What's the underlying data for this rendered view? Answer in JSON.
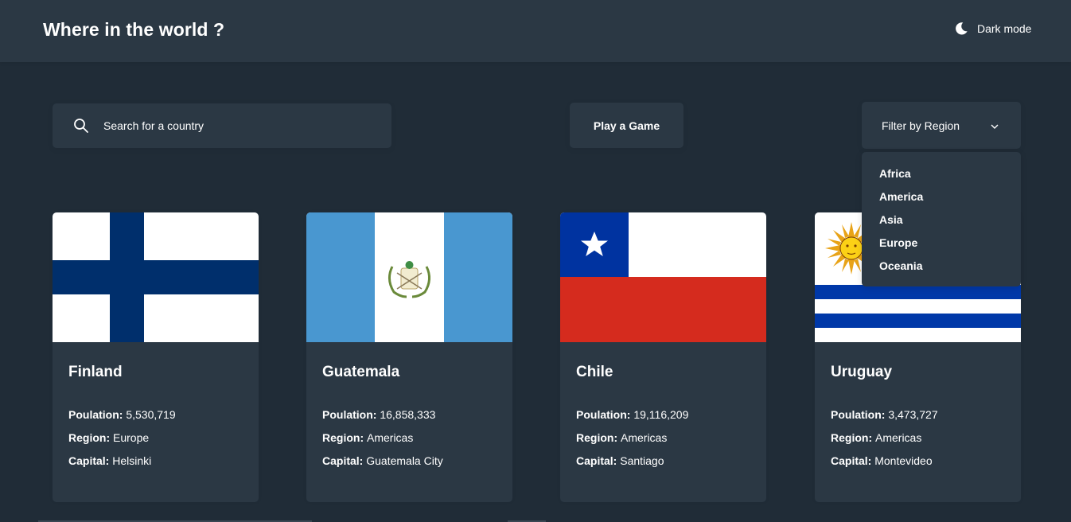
{
  "header": {
    "title": "Where in the world ?",
    "theme_toggle_label": "Dark mode",
    "theme_toggle_icon": "moon-icon"
  },
  "search": {
    "placeholder": "Search for a country",
    "value": "",
    "icon": "search-icon"
  },
  "game_button": {
    "label": "Play a Game"
  },
  "filter": {
    "label": "Filter by Region",
    "icon": "chevron-down-icon",
    "open": true,
    "options": [
      "Africa",
      "America",
      "Asia",
      "Europe",
      "Oceania"
    ]
  },
  "labels": {
    "population": "Poulation:",
    "region": "Region:",
    "capital": "Capital:"
  },
  "countries": [
    {
      "name": "Finland",
      "population": "5,530,719",
      "region": "Europe",
      "capital": "Helsinki",
      "flag": "finland-flag"
    },
    {
      "name": "Guatemala",
      "population": "16,858,333",
      "region": "Americas",
      "capital": "Guatemala City",
      "flag": "guatemala-flag"
    },
    {
      "name": "Chile",
      "population": "19,116,209",
      "region": "Americas",
      "capital": "Santiago",
      "flag": "chile-flag"
    },
    {
      "name": "Uruguay",
      "population": "3,473,727",
      "region": "Americas",
      "capital": "Montevideo",
      "flag": "uruguay-flag"
    }
  ],
  "colors": {
    "background": "#202c37",
    "element": "#2b3844",
    "text": "#ffffff",
    "finland_blue": "#002f6c",
    "guatemala_blue": "#4997d0",
    "chile_blue": "#0033a0",
    "chile_red": "#d52b1e",
    "uruguay_blue": "#0038a8",
    "sun_yellow": "#fcd116"
  }
}
